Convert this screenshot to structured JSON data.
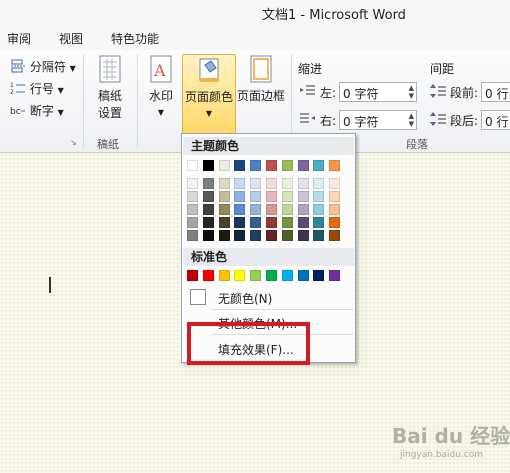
{
  "window": {
    "title": "文档1 - Microsoft Word"
  },
  "tabs": [
    {
      "label": "审阅"
    },
    {
      "label": "视图"
    },
    {
      "label": "特色功能"
    }
  ],
  "ribbon": {
    "page_setup": {
      "breaks_label": "分隔符",
      "line_numbers_label": "行号",
      "hyphenation_label": "断字"
    },
    "manuscript": {
      "button_label_line1": "稿纸",
      "button_label_line2": "设置",
      "group_label": "稿纸"
    },
    "page_background": {
      "watermark_label": "水印",
      "page_color_label": "页面颜色",
      "page_border_label": "页面边框"
    },
    "indent": {
      "title": "缩进",
      "left_label": "左:",
      "left_value": "0 字符",
      "right_label": "右:",
      "right_value": "0 字符"
    },
    "spacing": {
      "title": "间距",
      "before_label": "段前:",
      "before_value": "0 行",
      "after_label": "段后:",
      "after_value": "0 行"
    },
    "paragraph_group_label": "段落"
  },
  "color_menu": {
    "theme_colors_header": "主题颜色",
    "standard_colors_header": "标准色",
    "no_color_label": "无颜色(N)",
    "more_colors_label": "其他颜色(M)...",
    "fill_effects_label": "填充效果(F)...",
    "theme_top_row": [
      "#ffffff",
      "#000000",
      "#eeece1",
      "#1f497d",
      "#4f81bd",
      "#c0504d",
      "#9bbb59",
      "#8064a2",
      "#4bacc6",
      "#f79646"
    ],
    "theme_shades": [
      [
        "#f2f2f2",
        "#7f7f7f",
        "#ddd9c3",
        "#c6d9f0",
        "#dbe5f1",
        "#f2dcdb",
        "#ebf1dd",
        "#e5e0ec",
        "#dbeef3",
        "#fdeada"
      ],
      [
        "#d8d8d8",
        "#595959",
        "#c4bd97",
        "#8db3e2",
        "#b8cce4",
        "#e5b9b7",
        "#d7e3bc",
        "#ccc1d9",
        "#b7dde8",
        "#fbd5b5"
      ],
      [
        "#bfbfbf",
        "#3f3f3f",
        "#938953",
        "#548dd4",
        "#95b3d7",
        "#d99694",
        "#c3d69b",
        "#b2a2c7",
        "#92cddc",
        "#fac08f"
      ],
      [
        "#a5a5a5",
        "#262626",
        "#494429",
        "#17365d",
        "#366092",
        "#953734",
        "#76923c",
        "#5f497a",
        "#31859b",
        "#e36c09"
      ],
      [
        "#7f7f7f",
        "#0c0c0c",
        "#1d1b10",
        "#0f243e",
        "#244061",
        "#632423",
        "#4f6128",
        "#3f3151",
        "#205867",
        "#974806"
      ]
    ],
    "standard_colors": [
      "#c00000",
      "#ff0000",
      "#ffc000",
      "#ffff00",
      "#92d050",
      "#00b050",
      "#00b0f0",
      "#0070c0",
      "#002060",
      "#7030a0"
    ]
  },
  "watermark": {
    "text": "Bai du 经验",
    "sub": "jingyan.baidu.com"
  }
}
